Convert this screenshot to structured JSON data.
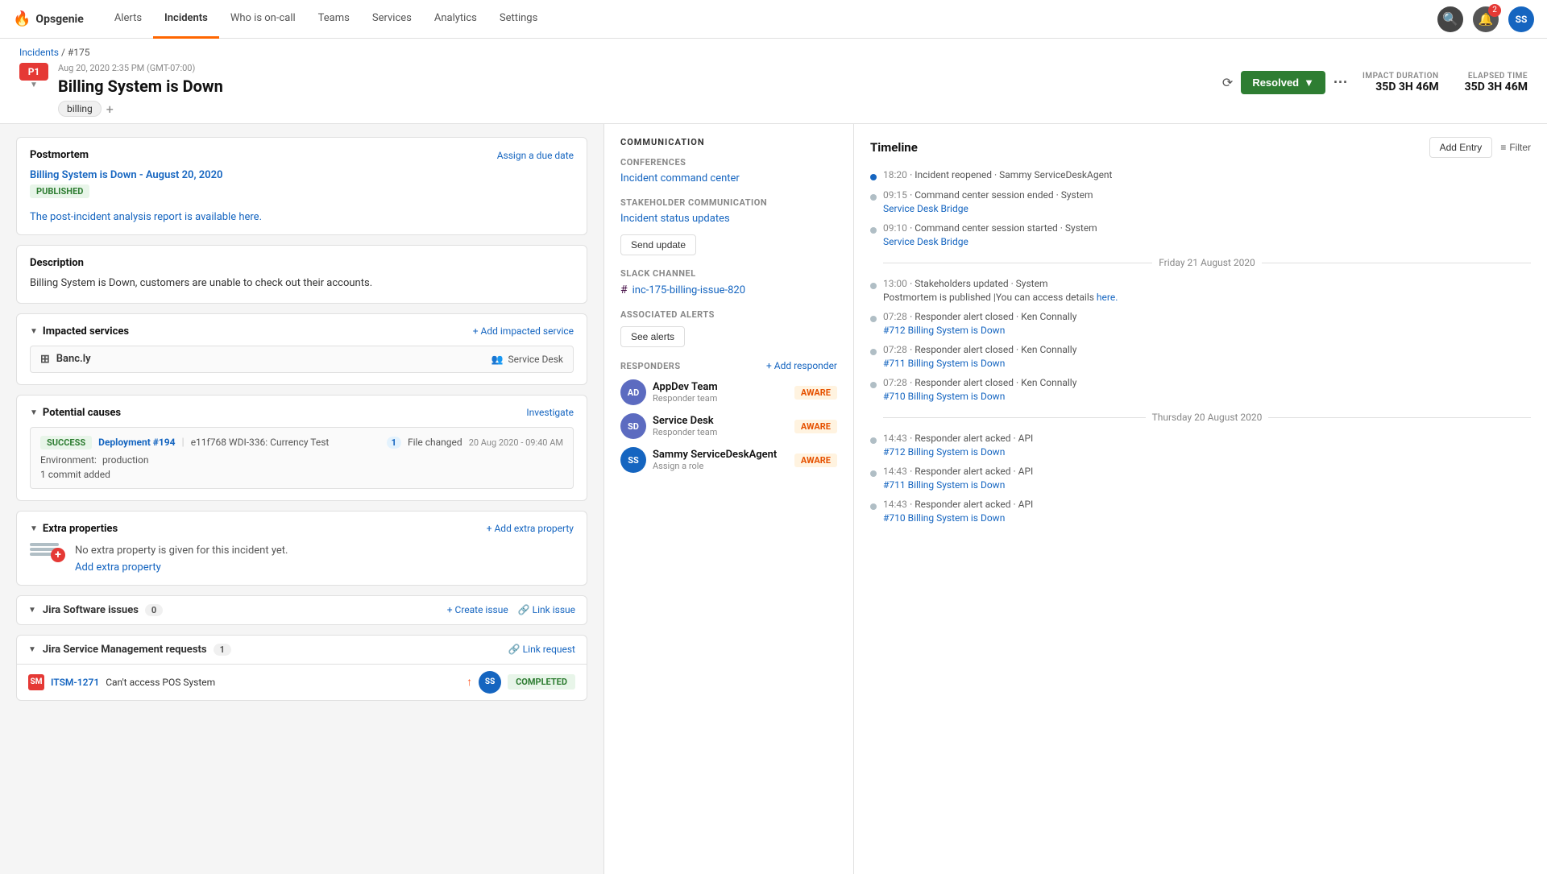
{
  "app": {
    "name": "Opsgenie",
    "logo": "🔥"
  },
  "nav": {
    "items": [
      {
        "label": "Alerts",
        "active": false
      },
      {
        "label": "Incidents",
        "active": true
      },
      {
        "label": "Who is on-call",
        "active": false
      },
      {
        "label": "Teams",
        "active": false
      },
      {
        "label": "Services",
        "active": false
      },
      {
        "label": "Analytics",
        "active": false
      },
      {
        "label": "Settings",
        "active": false
      }
    ],
    "notification_count": "2",
    "avatar_initials": "SS"
  },
  "breadcrumb": {
    "parent": "Incidents",
    "id": "#175"
  },
  "incident": {
    "priority": "P1",
    "date": "Aug 20, 2020 2:35 PM (GMT-07:00)",
    "title": "Billing System is Down",
    "tag": "billing",
    "status": "Resolved",
    "impact_duration_label": "IMPACT DURATION",
    "impact_duration": "35D 3H 46M",
    "elapsed_time_label": "ELAPSED TIME",
    "elapsed_time": "35D 3H 46M"
  },
  "postmortem": {
    "label": "Postmortem",
    "assign_due_date": "Assign a due date",
    "title": "Billing System is Down - August 20, 2020",
    "status": "PUBLISHED",
    "link_text": "The post-incident analysis report is available here."
  },
  "description": {
    "label": "Description",
    "text": "Billing System is Down, customers are unable to check out their accounts."
  },
  "impacted_services": {
    "label": "Impacted services",
    "add_link": "+ Add impacted service",
    "service_name": "Banc.ly",
    "service_team": "Service Desk"
  },
  "potential_causes": {
    "label": "Potential causes",
    "investigate_link": "Investigate",
    "cause": {
      "status": "SUCCESS",
      "deployment": "Deployment #194",
      "desc": "e11f768 WDI-336: Currency Test",
      "file_count": "1",
      "file_label": "File changed",
      "env_label": "Environment:",
      "env": "production",
      "date": "20 Aug 2020 - 09:40 AM",
      "commit": "1 commit added"
    }
  },
  "extra_properties": {
    "label": "Extra properties",
    "add_link": "+ Add extra property",
    "empty_text": "No extra property is given for this incident yet.",
    "add_label": "Add extra property"
  },
  "jira_software": {
    "label": "Jira Software issues",
    "count": "0",
    "create_issue": "+ Create issue",
    "link_issue": "🔗 Link issue"
  },
  "jira_service": {
    "label": "Jira Service Management requests",
    "count": "1",
    "link_request": "🔗 Link request",
    "request": {
      "id": "ITSM-1271",
      "title": "Can't access POS System",
      "status": "COMPLETED"
    }
  },
  "communication": {
    "section_title": "COMMUNICATION",
    "conferences_label": "Conferences",
    "conference_link": "Incident command center",
    "stakeholder_label": "Stakeholder communication",
    "stakeholder_link": "Incident status updates",
    "send_update": "Send update",
    "slack_label": "Slack channel",
    "slack_channel": "inc-175-billing-issue-820",
    "associated_alerts_title": "ASSOCIATED ALERTS",
    "see_alerts": "See alerts",
    "responders_title": "RESPONDERS",
    "add_responder": "+ Add responder",
    "responders": [
      {
        "name": "AppDev Team",
        "sub": "Responder team",
        "initials": "AD",
        "status": "AWARE"
      },
      {
        "name": "Service Desk",
        "sub": "Responder team",
        "initials": "SD",
        "status": "AWARE"
      },
      {
        "name": "Sammy ServiceDeskAgent",
        "sub": "Assign a role",
        "initials": "SS",
        "status": "AWARE"
      }
    ]
  },
  "timeline": {
    "title": "Timeline",
    "add_entry": "Add Entry",
    "filter": "Filter",
    "entries": [
      {
        "time": "18:20",
        "text": " · Incident reopened · Sammy ServiceDeskAgent",
        "link": null,
        "dot": "blue"
      },
      {
        "time": "09:15",
        "text": " · Command center session ended · System",
        "link": "Service Desk Bridge",
        "dot": "gray"
      },
      {
        "time": "09:10",
        "text": " · Command center session started · System",
        "link": "Service Desk Bridge",
        "dot": "gray"
      },
      {
        "divider": "Friday 21 August 2020"
      },
      {
        "time": "13:00",
        "text": " · Stakeholders updated · System",
        "link": null,
        "extra": "Postmortem is published |You can access details here.",
        "dot": "gray"
      },
      {
        "time": "07:28",
        "text": " · Responder alert closed · Ken Connally",
        "link": "#712 Billing System is Down",
        "dot": "gray"
      },
      {
        "time": "07:28",
        "text": " · Responder alert closed · Ken Connally",
        "link": "#711 Billing System is Down",
        "dot": "gray"
      },
      {
        "time": "07:28",
        "text": " · Responder alert closed · Ken Connally",
        "link": "#710 Billing System is Down",
        "dot": "gray"
      },
      {
        "divider": "Thursday 20 August 2020"
      },
      {
        "time": "14:43",
        "text": " · Responder alert acked · API",
        "link": "#712 Billing System is Down",
        "dot": "gray"
      },
      {
        "time": "14:43",
        "text": " · Responder alert acked · API",
        "link": "#711 Billing System is Down",
        "dot": "gray"
      },
      {
        "time": "14:43",
        "text": " · Responder alert acked · API",
        "link": "#710 Billing System is Down",
        "dot": "gray"
      }
    ]
  }
}
